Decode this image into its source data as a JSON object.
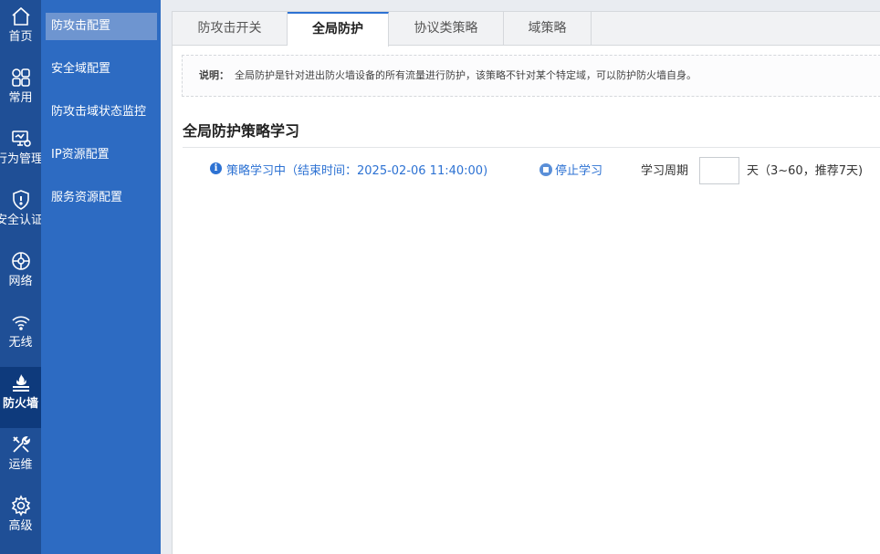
{
  "nav": {
    "items": [
      {
        "label": "首页",
        "icon": "home-icon"
      },
      {
        "label": "常用",
        "icon": "grid-icon"
      },
      {
        "label": "行为管理",
        "icon": "behavior-monitor-icon"
      },
      {
        "label": "安全认证",
        "icon": "shield-icon"
      },
      {
        "label": "网络",
        "icon": "network-globe-icon"
      },
      {
        "label": "无线",
        "icon": "wifi-icon"
      },
      {
        "label": "防火墙",
        "icon": "firewall-icon"
      },
      {
        "label": "运维",
        "icon": "tools-icon"
      },
      {
        "label": "高级",
        "icon": "gear-icon"
      }
    ],
    "active": "防火墙"
  },
  "submenu": {
    "items": [
      {
        "label": "防攻击配置"
      },
      {
        "label": "安全域配置"
      },
      {
        "label": "防攻击域状态监控"
      },
      {
        "label": "IP资源配置"
      },
      {
        "label": "服务资源配置"
      }
    ],
    "active": "防攻击配置"
  },
  "tabs": [
    {
      "label": "防攻击开关"
    },
    {
      "label": "全局防护"
    },
    {
      "label": "协议类策略"
    },
    {
      "label": "域策略"
    }
  ],
  "active_tab": "全局防护",
  "notice": {
    "title": "说明：",
    "text": "全局防护是针对进出防火墙设备的所有流量进行防护，该策略不针对某个特定域，可以防护防火墙自身。"
  },
  "section": {
    "title": "全局防护策略学习"
  },
  "learning": {
    "info_glyph": "i",
    "status": "策略学习中（结束时间：2025-02-06 11:40:00)",
    "stop_label": "停止学习",
    "period_label": "学习周期",
    "period_value": "",
    "period_hint": "天（3~60，推荐7天)"
  },
  "colors": {
    "nav_bg": "#1f4f96",
    "nav_active": "#0e3a7c",
    "submenu_bg": "#2d6bc2",
    "submenu_active": "#6e95d0",
    "accent": "#2d72d3"
  }
}
